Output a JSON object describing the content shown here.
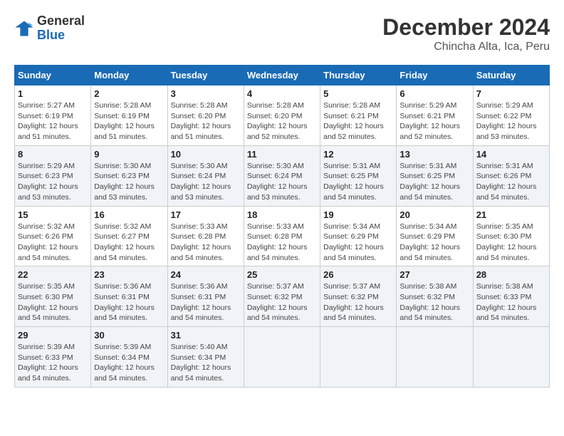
{
  "header": {
    "logo_general": "General",
    "logo_blue": "Blue",
    "month_title": "December 2024",
    "location": "Chincha Alta, Ica, Peru"
  },
  "weekdays": [
    "Sunday",
    "Monday",
    "Tuesday",
    "Wednesday",
    "Thursday",
    "Friday",
    "Saturday"
  ],
  "weeks": [
    [
      {
        "day": "1",
        "sunrise": "Sunrise: 5:27 AM",
        "sunset": "Sunset: 6:19 PM",
        "daylight": "Daylight: 12 hours and 51 minutes."
      },
      {
        "day": "2",
        "sunrise": "Sunrise: 5:28 AM",
        "sunset": "Sunset: 6:19 PM",
        "daylight": "Daylight: 12 hours and 51 minutes."
      },
      {
        "day": "3",
        "sunrise": "Sunrise: 5:28 AM",
        "sunset": "Sunset: 6:20 PM",
        "daylight": "Daylight: 12 hours and 51 minutes."
      },
      {
        "day": "4",
        "sunrise": "Sunrise: 5:28 AM",
        "sunset": "Sunset: 6:20 PM",
        "daylight": "Daylight: 12 hours and 52 minutes."
      },
      {
        "day": "5",
        "sunrise": "Sunrise: 5:28 AM",
        "sunset": "Sunset: 6:21 PM",
        "daylight": "Daylight: 12 hours and 52 minutes."
      },
      {
        "day": "6",
        "sunrise": "Sunrise: 5:29 AM",
        "sunset": "Sunset: 6:21 PM",
        "daylight": "Daylight: 12 hours and 52 minutes."
      },
      {
        "day": "7",
        "sunrise": "Sunrise: 5:29 AM",
        "sunset": "Sunset: 6:22 PM",
        "daylight": "Daylight: 12 hours and 53 minutes."
      }
    ],
    [
      {
        "day": "8",
        "sunrise": "Sunrise: 5:29 AM",
        "sunset": "Sunset: 6:23 PM",
        "daylight": "Daylight: 12 hours and 53 minutes."
      },
      {
        "day": "9",
        "sunrise": "Sunrise: 5:30 AM",
        "sunset": "Sunset: 6:23 PM",
        "daylight": "Daylight: 12 hours and 53 minutes."
      },
      {
        "day": "10",
        "sunrise": "Sunrise: 5:30 AM",
        "sunset": "Sunset: 6:24 PM",
        "daylight": "Daylight: 12 hours and 53 minutes."
      },
      {
        "day": "11",
        "sunrise": "Sunrise: 5:30 AM",
        "sunset": "Sunset: 6:24 PM",
        "daylight": "Daylight: 12 hours and 53 minutes."
      },
      {
        "day": "12",
        "sunrise": "Sunrise: 5:31 AM",
        "sunset": "Sunset: 6:25 PM",
        "daylight": "Daylight: 12 hours and 54 minutes."
      },
      {
        "day": "13",
        "sunrise": "Sunrise: 5:31 AM",
        "sunset": "Sunset: 6:25 PM",
        "daylight": "Daylight: 12 hours and 54 minutes."
      },
      {
        "day": "14",
        "sunrise": "Sunrise: 5:31 AM",
        "sunset": "Sunset: 6:26 PM",
        "daylight": "Daylight: 12 hours and 54 minutes."
      }
    ],
    [
      {
        "day": "15",
        "sunrise": "Sunrise: 5:32 AM",
        "sunset": "Sunset: 6:26 PM",
        "daylight": "Daylight: 12 hours and 54 minutes."
      },
      {
        "day": "16",
        "sunrise": "Sunrise: 5:32 AM",
        "sunset": "Sunset: 6:27 PM",
        "daylight": "Daylight: 12 hours and 54 minutes."
      },
      {
        "day": "17",
        "sunrise": "Sunrise: 5:33 AM",
        "sunset": "Sunset: 6:28 PM",
        "daylight": "Daylight: 12 hours and 54 minutes."
      },
      {
        "day": "18",
        "sunrise": "Sunrise: 5:33 AM",
        "sunset": "Sunset: 6:28 PM",
        "daylight": "Daylight: 12 hours and 54 minutes."
      },
      {
        "day": "19",
        "sunrise": "Sunrise: 5:34 AM",
        "sunset": "Sunset: 6:29 PM",
        "daylight": "Daylight: 12 hours and 54 minutes."
      },
      {
        "day": "20",
        "sunrise": "Sunrise: 5:34 AM",
        "sunset": "Sunset: 6:29 PM",
        "daylight": "Daylight: 12 hours and 54 minutes."
      },
      {
        "day": "21",
        "sunrise": "Sunrise: 5:35 AM",
        "sunset": "Sunset: 6:30 PM",
        "daylight": "Daylight: 12 hours and 54 minutes."
      }
    ],
    [
      {
        "day": "22",
        "sunrise": "Sunrise: 5:35 AM",
        "sunset": "Sunset: 6:30 PM",
        "daylight": "Daylight: 12 hours and 54 minutes."
      },
      {
        "day": "23",
        "sunrise": "Sunrise: 5:36 AM",
        "sunset": "Sunset: 6:31 PM",
        "daylight": "Daylight: 12 hours and 54 minutes."
      },
      {
        "day": "24",
        "sunrise": "Sunrise: 5:36 AM",
        "sunset": "Sunset: 6:31 PM",
        "daylight": "Daylight: 12 hours and 54 minutes."
      },
      {
        "day": "25",
        "sunrise": "Sunrise: 5:37 AM",
        "sunset": "Sunset: 6:32 PM",
        "daylight": "Daylight: 12 hours and 54 minutes."
      },
      {
        "day": "26",
        "sunrise": "Sunrise: 5:37 AM",
        "sunset": "Sunset: 6:32 PM",
        "daylight": "Daylight: 12 hours and 54 minutes."
      },
      {
        "day": "27",
        "sunrise": "Sunrise: 5:38 AM",
        "sunset": "Sunset: 6:32 PM",
        "daylight": "Daylight: 12 hours and 54 minutes."
      },
      {
        "day": "28",
        "sunrise": "Sunrise: 5:38 AM",
        "sunset": "Sunset: 6:33 PM",
        "daylight": "Daylight: 12 hours and 54 minutes."
      }
    ],
    [
      {
        "day": "29",
        "sunrise": "Sunrise: 5:39 AM",
        "sunset": "Sunset: 6:33 PM",
        "daylight": "Daylight: 12 hours and 54 minutes."
      },
      {
        "day": "30",
        "sunrise": "Sunrise: 5:39 AM",
        "sunset": "Sunset: 6:34 PM",
        "daylight": "Daylight: 12 hours and 54 minutes."
      },
      {
        "day": "31",
        "sunrise": "Sunrise: 5:40 AM",
        "sunset": "Sunset: 6:34 PM",
        "daylight": "Daylight: 12 hours and 54 minutes."
      },
      null,
      null,
      null,
      null
    ]
  ]
}
